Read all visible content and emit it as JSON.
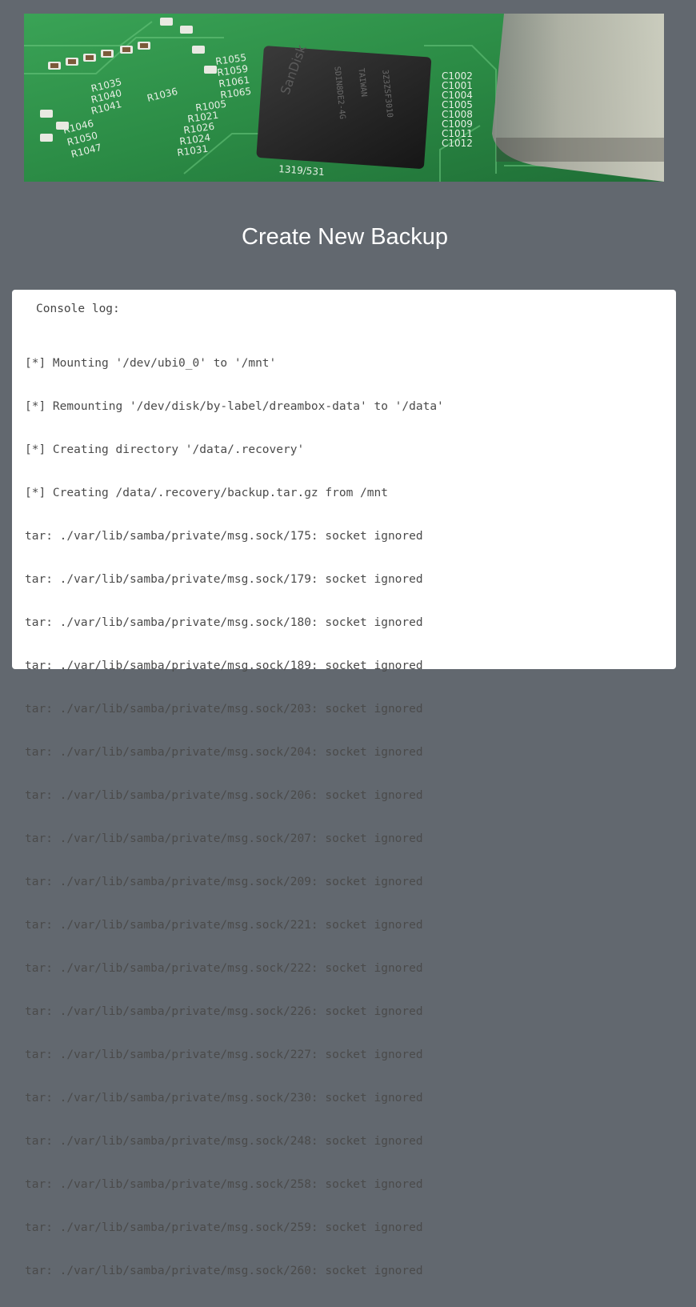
{
  "banner": {
    "chip_brand": "SanDisk",
    "chip_code": "SDIN8DE2-4G",
    "chip_origin": "TAIWAN",
    "chip_lot": "3Z3ZSF3010",
    "board_refs_left": [
      "R1035",
      "R1040",
      "R1041",
      "R1036",
      "R1046",
      "R1050",
      "R1047"
    ],
    "board_refs_mid": [
      "R1055",
      "R1059",
      "R1061",
      "R1065",
      "R1005",
      "R1021",
      "R1026",
      "R1024",
      "R1031"
    ],
    "board_refs_right": [
      "C1002",
      "C1001",
      "C1004",
      "C1005",
      "C1008",
      "C1009",
      "C1011",
      "C1012"
    ],
    "board_ref_bottom": "1319/531"
  },
  "page": {
    "title": "Create New Backup"
  },
  "console": {
    "label": "Console log:",
    "lines": [
      "[*] Mounting '/dev/ubi0_0' to '/mnt'",
      "[*] Remounting '/dev/disk/by-label/dreambox-data' to '/data'",
      "[*] Creating directory '/data/.recovery'",
      "[*] Creating /data/.recovery/backup.tar.gz from /mnt",
      "tar: ./var/lib/samba/private/msg.sock/175: socket ignored",
      "tar: ./var/lib/samba/private/msg.sock/179: socket ignored",
      "tar: ./var/lib/samba/private/msg.sock/180: socket ignored",
      "tar: ./var/lib/samba/private/msg.sock/189: socket ignored",
      "tar: ./var/lib/samba/private/msg.sock/203: socket ignored",
      "tar: ./var/lib/samba/private/msg.sock/204: socket ignored",
      "tar: ./var/lib/samba/private/msg.sock/206: socket ignored",
      "tar: ./var/lib/samba/private/msg.sock/207: socket ignored",
      "tar: ./var/lib/samba/private/msg.sock/209: socket ignored",
      "tar: ./var/lib/samba/private/msg.sock/221: socket ignored",
      "tar: ./var/lib/samba/private/msg.sock/222: socket ignored",
      "tar: ./var/lib/samba/private/msg.sock/226: socket ignored",
      "tar: ./var/lib/samba/private/msg.sock/227: socket ignored",
      "tar: ./var/lib/samba/private/msg.sock/230: socket ignored",
      "tar: ./var/lib/samba/private/msg.sock/248: socket ignored",
      "tar: ./var/lib/samba/private/msg.sock/258: socket ignored",
      "tar: ./var/lib/samba/private/msg.sock/259: socket ignored",
      "tar: ./var/lib/samba/private/msg.sock/260: socket ignored"
    ]
  },
  "colors": {
    "background": "#62686f",
    "panel": "#ffffff",
    "pcb_green": "#2c8a45",
    "log_text": "#4a4a4a"
  }
}
